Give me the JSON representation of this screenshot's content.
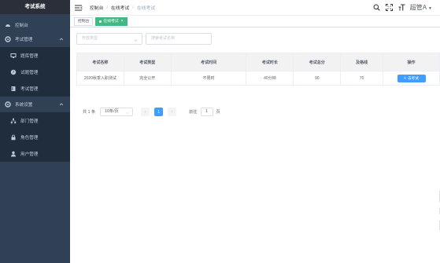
{
  "sidebar": {
    "brand": "考试系统",
    "items": [
      {
        "label": "控制台",
        "icon": "dashboard-icon"
      },
      {
        "label": "考试管理",
        "icon": "gear-icon",
        "expanded": true,
        "children": [
          {
            "label": "题库管理",
            "icon": "monitor-icon"
          },
          {
            "label": "试题管理",
            "icon": "question-icon"
          },
          {
            "label": "考试管理",
            "icon": "book-icon"
          }
        ]
      },
      {
        "label": "系统设置",
        "icon": "gear-icon",
        "expanded": true,
        "children": [
          {
            "label": "部门管理",
            "icon": "org-icon"
          },
          {
            "label": "角色管理",
            "icon": "lock-icon"
          },
          {
            "label": "用户管理",
            "icon": "user-icon"
          }
        ]
      }
    ]
  },
  "header": {
    "breadcrumb": [
      "控制台",
      "在线考试",
      "在线考试"
    ],
    "user": "超管A"
  },
  "tags": [
    {
      "label": "控制台",
      "active": false
    },
    {
      "label": "在线考试",
      "active": true
    }
  ],
  "filters": {
    "type_placeholder": "开放类型",
    "search_placeholder": "搜索考试名称"
  },
  "table": {
    "columns": [
      "考试名称",
      "考试类型",
      "考试时间",
      "考试时长",
      "考试总分",
      "及格线",
      "操作"
    ],
    "rows": [
      {
        "name": "2020秋季入职测试",
        "type": "完全公开",
        "time": "不限时",
        "duration": "40分钟",
        "total": "90",
        "pass": "70",
        "action": "去考试"
      }
    ]
  },
  "pagination": {
    "total_text": "共 1 条",
    "page_size": "10条/页",
    "prev": "‹",
    "current": "1",
    "next": "›",
    "goto_label": "前往",
    "goto_value": "1",
    "page_suffix": "页"
  },
  "colors": {
    "sidebar_bg": "#304156",
    "brand_bg": "#2b2f3a",
    "submenu_bg": "#1f2d3d",
    "tag_active": "#42b983",
    "primary": "#409eff"
  }
}
